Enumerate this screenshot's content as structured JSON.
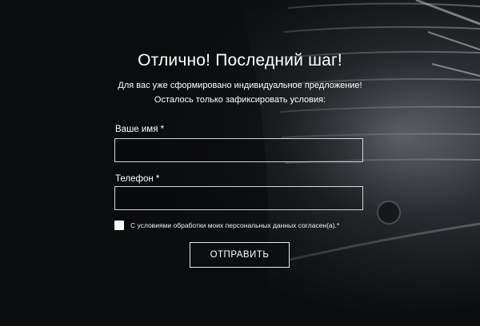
{
  "form": {
    "title": "Отлично! Последний шаг!",
    "subtitle_line1": "Для вас уже сформировано индивидуальное предложение!",
    "subtitle_line2": "Осталось только зафиксировать условия:",
    "name_label": "Ваше имя *",
    "name_value": "",
    "phone_label": "Телефон *",
    "phone_value": "",
    "consent_text": "С условиями обработки моих персональных данных согласен(а).*",
    "consent_checked": false,
    "submit_label": "ОТПРАВИТЬ"
  },
  "colors": {
    "background": "#0b0c0e",
    "text": "#ffffff",
    "border": "#d6d6d6"
  }
}
